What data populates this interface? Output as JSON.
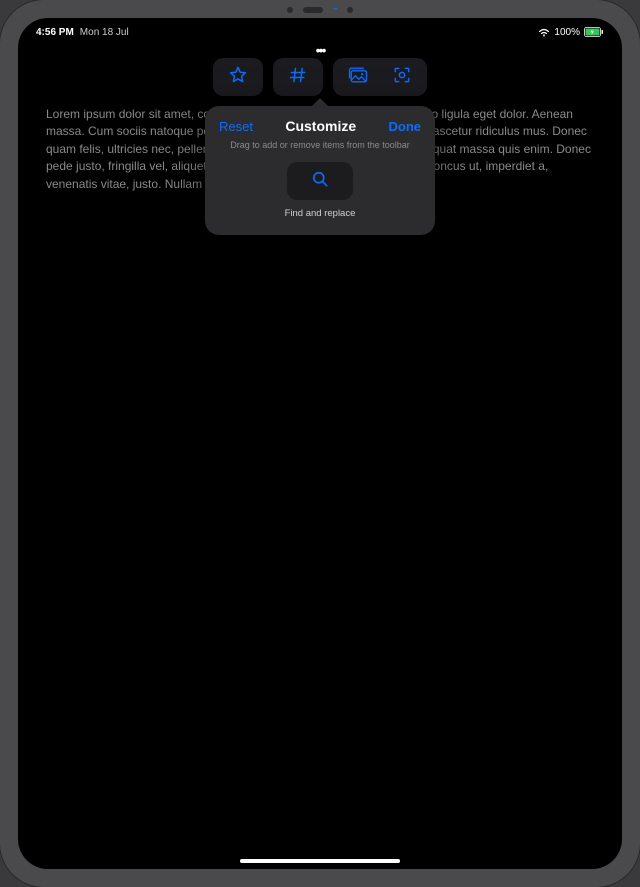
{
  "status": {
    "time": "4:56 PM",
    "date": "Mon 18 Jul",
    "battery_text": "100%"
  },
  "toolbar": {
    "items": [
      {
        "name": "star-icon"
      },
      {
        "name": "number-icon"
      },
      {
        "name": "photo-icon"
      },
      {
        "name": "scan-icon"
      }
    ]
  },
  "body": {
    "text": "Lorem ipsum dolor sit amet, consectetuer adipiscing elit. Aenea commodo ligula eget dolor. Aenean massa. Cum sociis natoque penatibus et magnis dis parturient montes, nascetur ridiculus mus. Donec quam felis, ultricies nec, pellentesque eu, pretium quis, sem. Nulla consequat massa quis enim. Donec pede justo, fringilla vel, aliquet nec, vulputate eget, arcu. In enim justo, rhoncus ut, imperdiet a, venenatis vitae, justo. Nullam dictum felis."
  },
  "popover": {
    "reset": "Reset",
    "title": "Customize",
    "done": "Done",
    "subtitle": "Drag to add or remove items from the toolbar",
    "item_label": "Find and replace"
  },
  "colors": {
    "accent": "#0a6dff"
  }
}
